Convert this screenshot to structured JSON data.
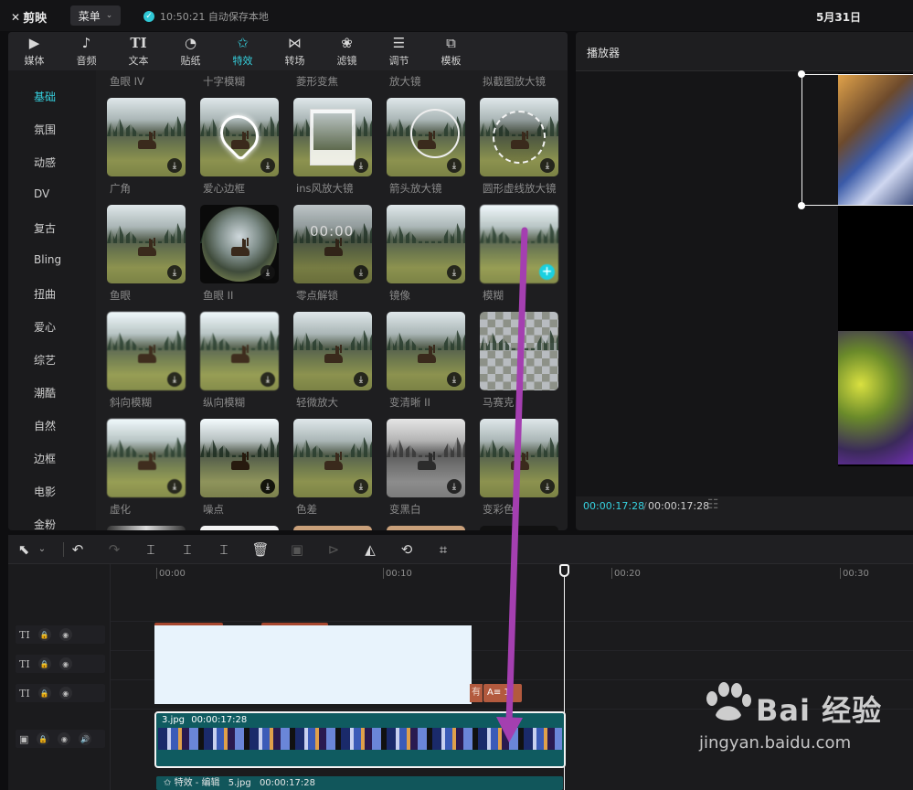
{
  "titlebar": {
    "logo": "剪映",
    "menu": "菜单",
    "save_status": "10:50:21 自动保存本地",
    "project_date": "5月31日"
  },
  "toolbar": {
    "tabs": [
      {
        "label": "媒体",
        "icon": "media-icon"
      },
      {
        "label": "音频",
        "icon": "audio-icon"
      },
      {
        "label": "文本",
        "icon": "text-icon"
      },
      {
        "label": "贴纸",
        "icon": "sticker-icon"
      },
      {
        "label": "特效",
        "icon": "effects-icon"
      },
      {
        "label": "转场",
        "icon": "transition-icon"
      },
      {
        "label": "滤镜",
        "icon": "filter-icon"
      },
      {
        "label": "调节",
        "icon": "adjust-icon"
      },
      {
        "label": "模板",
        "icon": "template-icon"
      }
    ],
    "active": "特效"
  },
  "sidebar": {
    "items": [
      "基础",
      "氛围",
      "动感",
      "DV",
      "复古",
      "Bling",
      "扭曲",
      "爱心",
      "综艺",
      "潮酷",
      "自然",
      "边框",
      "电影",
      "金粉"
    ],
    "active": "基础"
  },
  "effects": {
    "top_row_labels": [
      "鱼眼 IV",
      "十字模糊",
      "菱形变焦",
      "放大镜",
      "拟截图放大镜"
    ],
    "rows": [
      [
        "广角",
        "爱心边框",
        "ins风放大镜",
        "箭头放大镜",
        "圆形虚线放大镜"
      ],
      [
        "鱼眼",
        "鱼眼 II",
        "零点解锁",
        "镜像",
        "模糊"
      ],
      [
        "斜向模糊",
        "纵向模糊",
        "轻微放大",
        "变清晰 II",
        "马赛克"
      ],
      [
        "虚化",
        "噪点",
        "色差",
        "变黑白",
        "变彩色"
      ]
    ],
    "countdown_text": "00:00"
  },
  "player": {
    "title": "播放器",
    "current_time": "00:00:17:28",
    "separator": "/",
    "total_time": "00:00:17:28"
  },
  "timeline": {
    "ruler": [
      "00:00",
      "00:10",
      "00:20",
      "00:30"
    ],
    "text_tracks": [
      "TI",
      "TI",
      "TI"
    ],
    "text_chip_1": "有",
    "text_chip_2": "A≡ 1",
    "main_clip": {
      "name": "3.jpg",
      "duration": "00:00:17:28"
    },
    "fx_clip": {
      "label": "特效 - 编辑",
      "name": "5.jpg",
      "duration": "00:00:17:28"
    }
  },
  "watermark": {
    "title": "Bai 经验",
    "url": "jingyan.baidu.com"
  },
  "colors": {
    "accent": "#36d2e0",
    "arrow": "#a43fb0",
    "main_clip": "#0f5b60"
  }
}
